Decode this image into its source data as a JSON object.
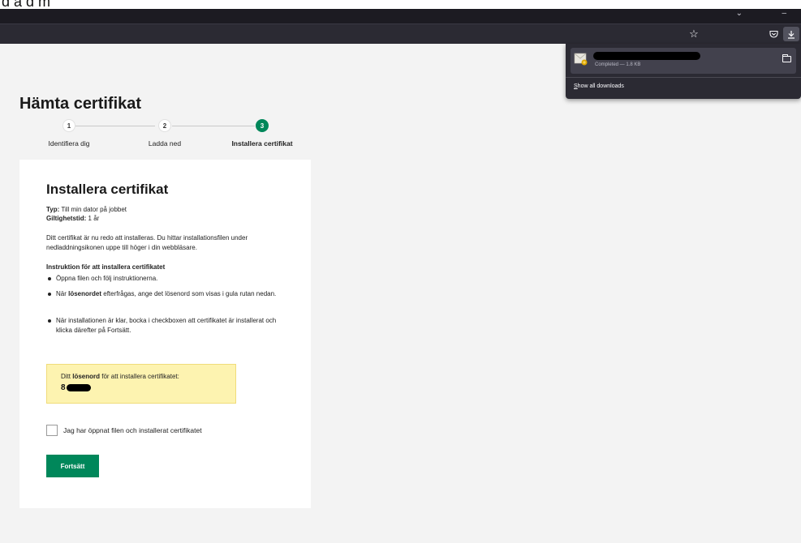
{
  "top_strip": {
    "cropped_text": "d a d m"
  },
  "browser": {
    "toolbar_icons": [
      "star-icon",
      "pocket-icon",
      "download-icon"
    ],
    "window_controls": [
      "chevron-down-icon",
      "minimize-icon"
    ]
  },
  "downloads_panel": {
    "item_status": "Completed — 1.8 KB",
    "show_all_prefix": "S",
    "show_all_rest": "how all downloads"
  },
  "page": {
    "title": "Hämta certifikat",
    "steps": [
      {
        "number": "1",
        "label": "Identifiera dig",
        "active": false
      },
      {
        "number": "2",
        "label": "Ladda ned",
        "active": false
      },
      {
        "number": "3",
        "label": "Installera certifikat",
        "active": true
      }
    ],
    "card": {
      "title": "Installera certifikat",
      "type_label": "Typ:",
      "type_value": " Till min dator på jobbet",
      "validity_label": "Giltighetstid:",
      "validity_value": " 1 år",
      "intro_text": "Ditt certifikat är nu redo att installeras. Du hittar installationsfilen under nedladdningsikonen uppe till höger i din webbläsare.",
      "instructions_heading": "Instruktion för att installera certifikatet",
      "bullets": [
        {
          "prefix": "Öppna filen och följ instruktionerna.",
          "bold": "",
          "suffix": ""
        },
        {
          "prefix": "När ",
          "bold": "lösenordet",
          "suffix": " efterfrågas, ange det lösenord som visas i gula rutan nedan."
        },
        {
          "prefix": "När installationen är klar, bocka i checkboxen att certifikatet är installerat och klicka därefter på Fortsätt.",
          "bold": "",
          "suffix": ""
        }
      ],
      "password_label_prefix": "Ditt ",
      "password_label_bold": "lösenord",
      "password_label_suffix": " för att installera certifikatet:",
      "password_visible_char": "8",
      "checkbox_label": "Jag har öppnat filen och installerat certifikatet",
      "continue_button": "Fortsätt"
    }
  },
  "colors": {
    "accent_green": "#00875a",
    "password_box_bg": "#fdf3b0",
    "browser_dark": "#2b2a33",
    "page_bg": "#f3f3f3"
  }
}
